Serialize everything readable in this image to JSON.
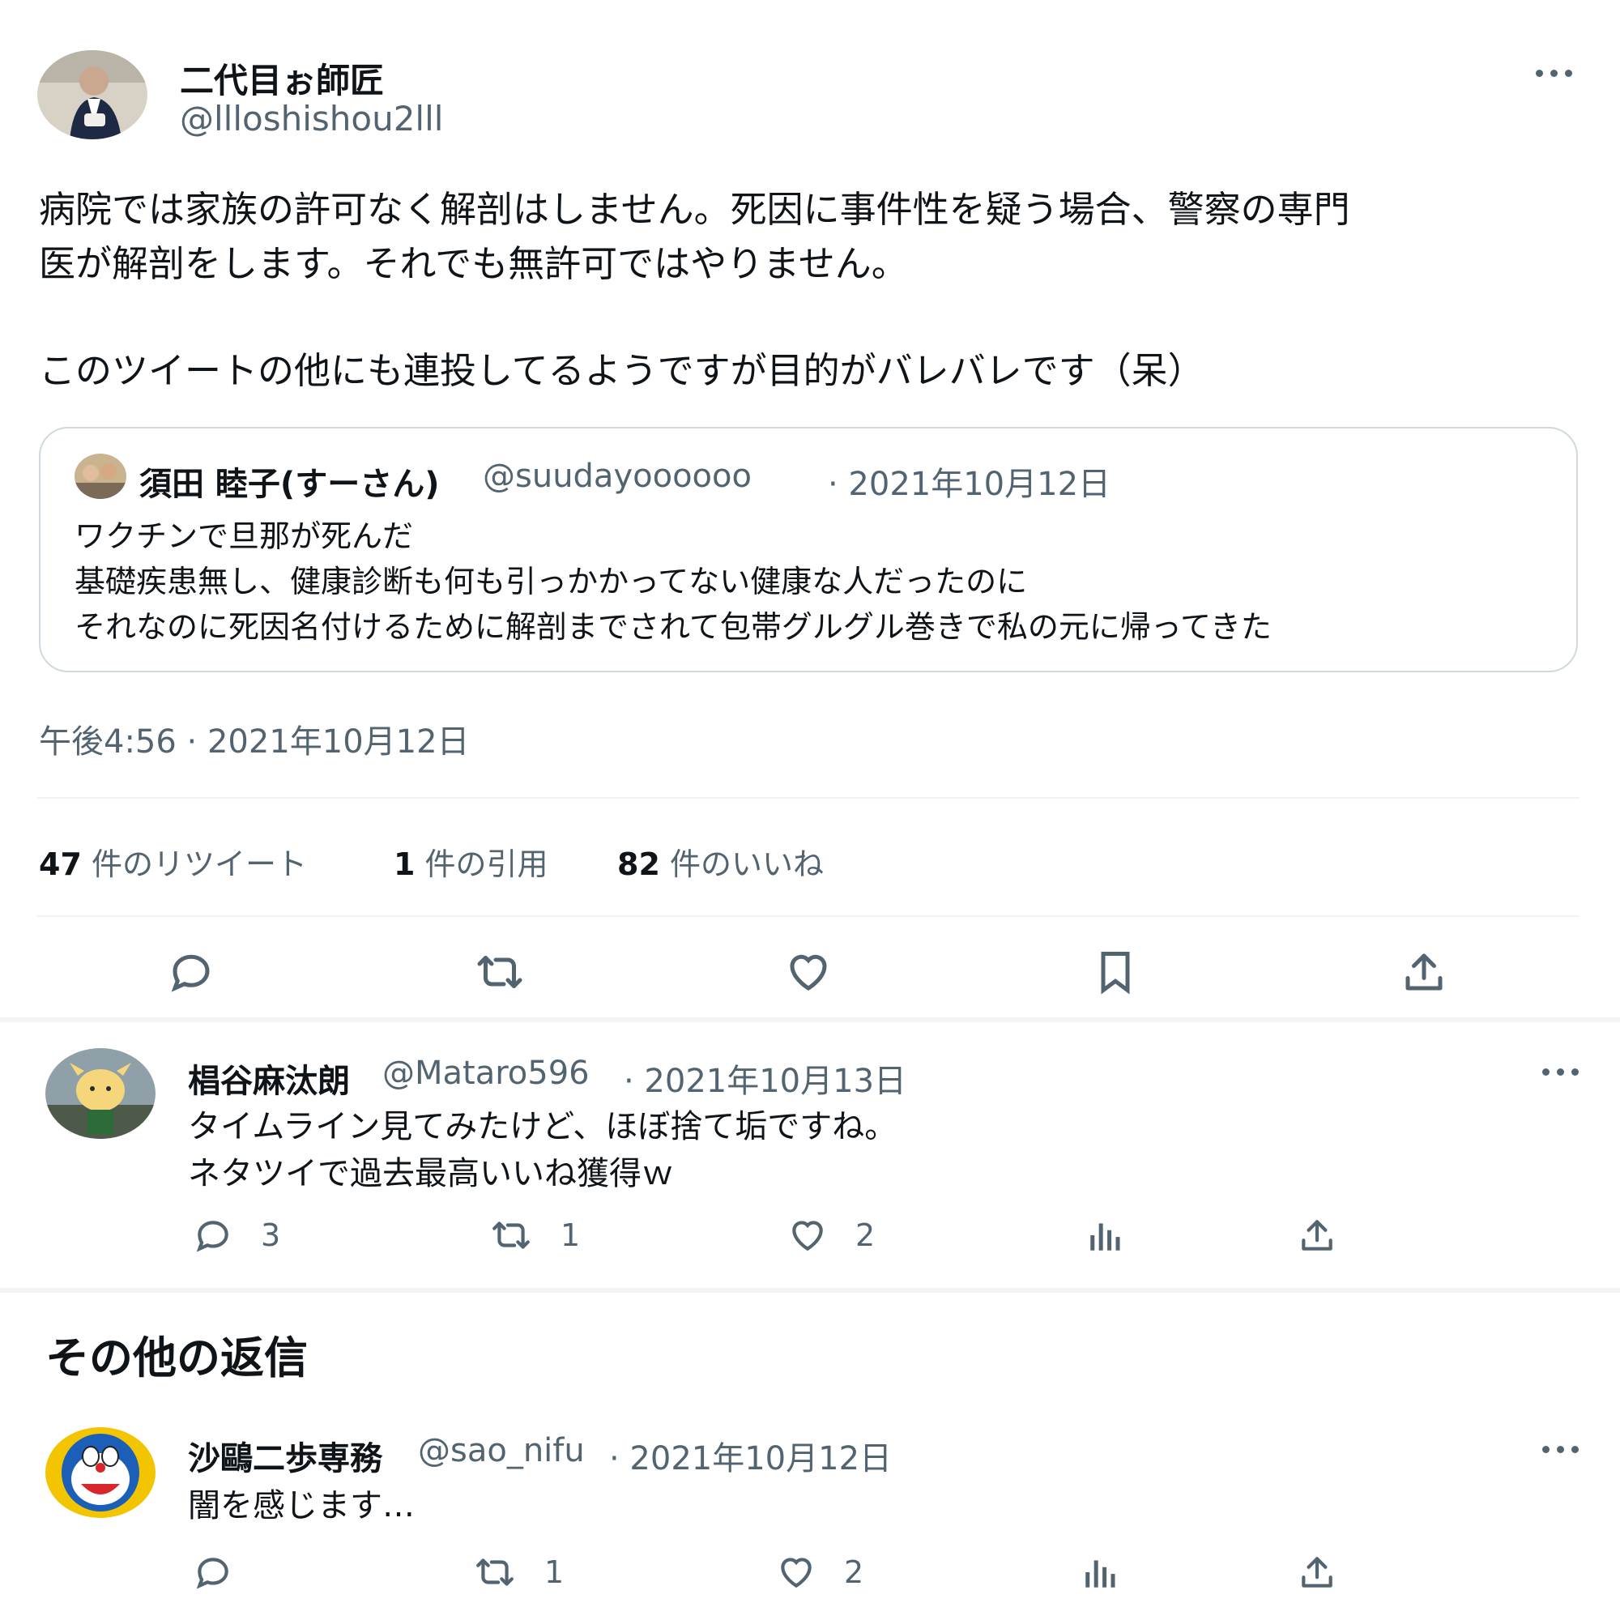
{
  "main_tweet": {
    "display_name": "二代目ぉ師匠",
    "handle": "@llloshishou2lll",
    "text_line1": "病院では家族の許可なく解剖はしません。死因に事件性を疑う場合、警察の専門",
    "text_line2": "医が解剖をします。それでも無許可ではやりません。",
    "text_line3": "このツイートの他にも連投してるようですが目的がバレバレです（呆）",
    "timestamp": "午後4:56 · 2021年10月12日"
  },
  "quoted_tweet": {
    "display_name": "須田 睦子(すーさん)",
    "handle": "@suudayoooooo",
    "date": "· 2021年10月12日",
    "line1": "ワクチンで旦那が死んだ",
    "line2": "基礎疾患無し、健康診断も何も引っかかってない健康な人だったのに",
    "line3": "それなのに死因名付けるために解剖までされて包帯グルグル巻きで私の元に帰ってきた"
  },
  "stats": {
    "retweets_count": "47",
    "retweets_label": "件のリツイート",
    "quotes_count": "1",
    "quotes_label": "件の引用",
    "likes_count": "82",
    "likes_label": "件のいいね"
  },
  "main_actions": [
    "reply-icon",
    "retweet-icon",
    "like-icon",
    "bookmark-icon",
    "share-icon"
  ],
  "reply1": {
    "display_name": "椙谷麻汰朗",
    "handle": "@Mataro596",
    "date": "· 2021年10月13日",
    "line1": "タイムライン見てみたけど、ほぼ捨て垢ですね。",
    "line2": "ネタツイで過去最高いいね獲得ｗ",
    "replies": "3",
    "retweets": "1",
    "likes": "2"
  },
  "section_title": "その他の返信",
  "reply2": {
    "display_name": "沙鷗二歩専務",
    "handle": "@sao_nifu",
    "date": "· 2021年10月12日",
    "line1": "闇を感じます…",
    "retweets": "1",
    "likes": "2"
  },
  "colors": {
    "text": "#0f1419",
    "muted": "#536471",
    "border": "#cfd9de",
    "divider": "#eff3f4"
  }
}
